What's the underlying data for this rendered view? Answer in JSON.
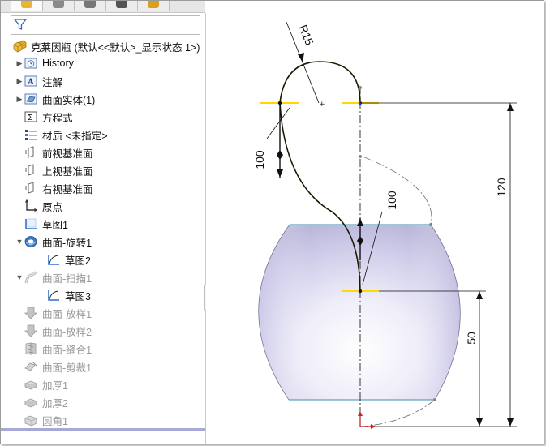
{
  "tree": {
    "root_label": "克莱因瓶 (默认<<默认>_显示状态 1>)",
    "items": [
      {
        "label": "History",
        "state": "normal",
        "icon": "history-icon",
        "caret": "collapsed"
      },
      {
        "label": "注解",
        "state": "normal",
        "icon": "annotation-icon",
        "caret": "collapsed"
      },
      {
        "label": "曲面实体(1)",
        "state": "normal",
        "icon": "surface-bodies-icon",
        "caret": "collapsed"
      },
      {
        "label": "方程式",
        "state": "normal",
        "icon": "equation-icon",
        "caret": "none"
      },
      {
        "label": "材质 <未指定>",
        "state": "normal",
        "icon": "material-icon",
        "caret": "none"
      },
      {
        "label": "前视基准面",
        "state": "normal",
        "icon": "plane-icon",
        "caret": "none"
      },
      {
        "label": "上视基准面",
        "state": "normal",
        "icon": "plane-icon",
        "caret": "none"
      },
      {
        "label": "右视基准面",
        "state": "normal",
        "icon": "plane-icon",
        "caret": "none"
      },
      {
        "label": "原点",
        "state": "normal",
        "icon": "origin-icon",
        "caret": "none"
      },
      {
        "label": "草图1",
        "state": "normal",
        "icon": "sketch-icon",
        "caret": "none"
      },
      {
        "label": "曲面-旋转1",
        "state": "normal",
        "icon": "revolve-icon",
        "caret": "expanded"
      },
      {
        "label": "草图2",
        "state": "child",
        "icon": "sketch-icon",
        "caret": "none"
      },
      {
        "label": "曲面-扫描1",
        "state": "dim",
        "icon": "sweep-icon",
        "caret": "expanded"
      },
      {
        "label": "草图3",
        "state": "child",
        "icon": "sketch-icon",
        "caret": "none"
      },
      {
        "label": "曲面-放样1",
        "state": "dim",
        "icon": "loft-icon",
        "caret": "none"
      },
      {
        "label": "曲面-放样2",
        "state": "dim",
        "icon": "loft-icon",
        "caret": "none"
      },
      {
        "label": "曲面-缝合1",
        "state": "dim",
        "icon": "knit-icon",
        "caret": "none"
      },
      {
        "label": "曲面-剪裁1",
        "state": "dim",
        "icon": "trim-icon",
        "caret": "none"
      },
      {
        "label": "加厚1",
        "state": "dim",
        "icon": "thicken-icon",
        "caret": "none"
      },
      {
        "label": "加厚2",
        "state": "dim",
        "icon": "thicken-icon",
        "caret": "none"
      },
      {
        "label": "圆角1",
        "state": "dim",
        "icon": "fillet-icon",
        "caret": "none"
      }
    ]
  },
  "viewport": {
    "dimensions": {
      "radius": "R15",
      "upper_length": "100",
      "middle_length": "100",
      "overall_height": "120",
      "lower_height": "50"
    }
  },
  "colors": {
    "accent_blue": "#2f6fcf",
    "sketch_yellow": "#ffd800",
    "dim_gray": "#9a9a9a",
    "surface_tint": "#c9c6e6"
  }
}
